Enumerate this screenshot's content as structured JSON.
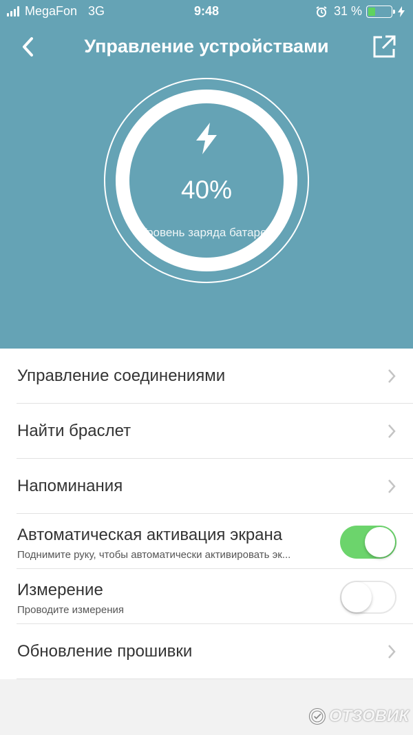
{
  "status_bar": {
    "carrier": "MegaFon",
    "network": "3G",
    "time": "9:48",
    "battery_percent": "31 %",
    "battery_level": 0.31
  },
  "nav": {
    "title": "Управление устройствами"
  },
  "battery_gauge": {
    "value": "40%",
    "level": 0.4,
    "label": "Уровень заряда батареи"
  },
  "menu": {
    "items": [
      {
        "label": "Управление соединениями",
        "type": "link"
      },
      {
        "label": "Найти браслет",
        "type": "link"
      },
      {
        "label": "Напоминания",
        "type": "link"
      },
      {
        "label": "Автоматическая активация экрана",
        "subtitle": "Поднимите руку, чтобы автоматически активировать эк...",
        "type": "toggle",
        "on": true
      },
      {
        "label": "Измерение",
        "subtitle": "Проводите измерения",
        "type": "toggle",
        "on": false
      },
      {
        "label": "Обновление прошивки",
        "type": "link"
      }
    ]
  },
  "watermark": {
    "text": "ОТЗОВИК"
  },
  "colors": {
    "header": "#65a3b5",
    "toggle_on": "#6cd46c",
    "battery_fill": "#5fd35f"
  },
  "icons": [
    "signal-icon",
    "alarm-icon",
    "battery-icon",
    "charging-icon",
    "back-icon",
    "share-icon",
    "bolt-icon",
    "chevron-right-icon"
  ]
}
